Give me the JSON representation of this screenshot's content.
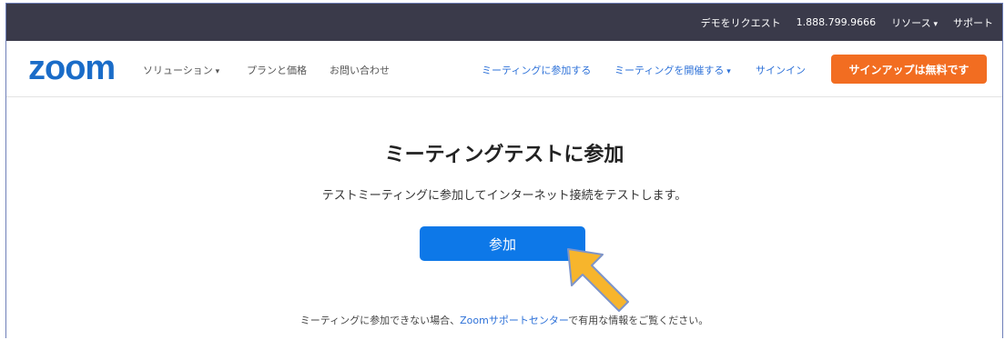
{
  "topbar": {
    "request_demo": "デモをリクエスト",
    "phone": "1.888.799.9666",
    "resources": "リソース",
    "support": "サポート"
  },
  "nav": {
    "logo": "zoom",
    "solutions": "ソリューション",
    "plans": "プランと価格",
    "contact": "お問い合わせ",
    "join_meeting": "ミーティングに参加する",
    "host_meeting": "ミーティングを開催する",
    "sign_in": "サインイン",
    "sign_up": "サインアップは無料です"
  },
  "main": {
    "title": "ミーティングテストに参加",
    "subtitle": "テストミーティングに参加してインターネット接続をテストします。",
    "join_button": "参加"
  },
  "footer": {
    "prefix": "ミーティングに参加できない場合、",
    "link": "Zoomサポートセンター",
    "suffix": "で有用な情報をご覧ください。"
  },
  "colors": {
    "brand": "#1a6cc8",
    "topbar_bg": "#3a3a4a",
    "signup_bg": "#f26d21",
    "join_bg": "#0d78e8",
    "arrow_fill": "#f7b52c"
  },
  "icons": {
    "pointer_arrow": "arrow-up-left-icon"
  }
}
